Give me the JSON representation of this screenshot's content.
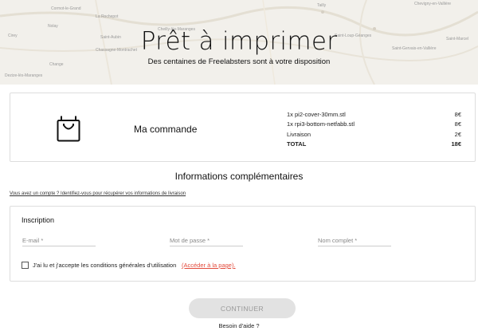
{
  "hero": {
    "title": "Prêt à imprimer",
    "subtitle": "Des centaines de Freelabsters sont à votre disposition",
    "map_labels": [
      "Cormot-le-Grand",
      "La Rochepot",
      "Nolay",
      "Saint-Aubin",
      "Chassagne-Montrachet",
      "Change",
      "Cheilly-lès-Maranges",
      "Saint-Loup-Géanges",
      "Saint-Marcel",
      "Saint-Gervais-en-Vallière",
      "Tailly",
      "Cirey",
      "Dezize-lès-Maranges",
      "Chevigny-en-Vallière"
    ]
  },
  "order": {
    "title": "Ma commande",
    "icon": "shopping-bag-icon",
    "lines": [
      {
        "label": "1x pi2-cover-30mm.stl",
        "price": "8€"
      },
      {
        "label": "1x rpi3-bottom-netfabb.stl",
        "price": "8€"
      },
      {
        "label": "Livraison",
        "price": "2€"
      }
    ],
    "total": {
      "label": "TOTAL",
      "price": "18€"
    }
  },
  "section": {
    "title": "Informations complémentaires",
    "login_link": "Vous avez un compte ? Identifiez-vous pour récupérer vos informations de livraison"
  },
  "form": {
    "title": "Inscription",
    "email_placeholder": "E-mail *",
    "password_placeholder": "Mot de passe *",
    "name_placeholder": "Nom complet *",
    "cgu_text": "J'ai lu et j'accepte les conditions générales d'utilisation",
    "cgu_link": "(Accéder à la page)."
  },
  "actions": {
    "continue_label": "CONTINUER",
    "help_label": "Besoin d'aide ?"
  },
  "colors": {
    "accent_link": "#e24a3b",
    "button_disabled_bg": "#e2e2e2",
    "border": "#dddddd"
  }
}
